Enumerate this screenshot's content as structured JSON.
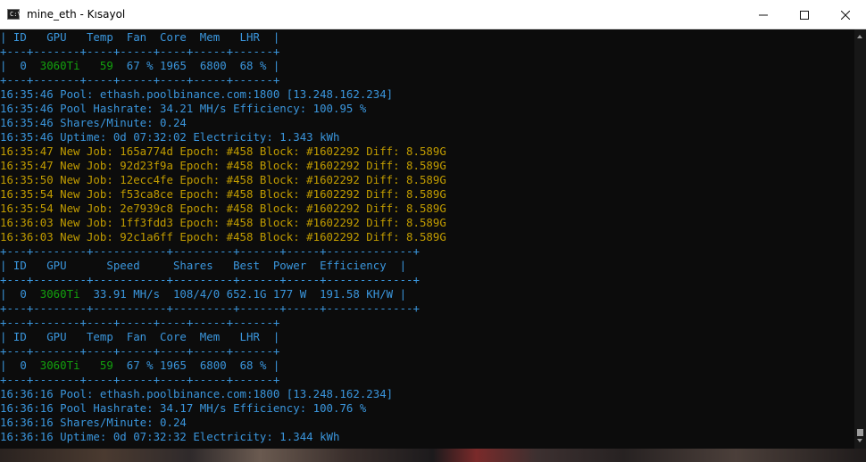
{
  "window": {
    "title": "mine_eth - Kısayol",
    "icon_name": "console-app-icon",
    "icon_glyph": "C:\\",
    "controls": {
      "minimize": "minimize-icon",
      "maximize": "maximize-icon",
      "close": "close-icon"
    }
  },
  "colors": {
    "background": "#0c0c0c",
    "cyan": "#3a96dd",
    "yellow": "#c19c00",
    "green": "#13a10e"
  },
  "console": {
    "lines": [
      {
        "text": "| ID   GPU   Temp  Fan  Core  Mem   LHR  |",
        "color": "cyan"
      },
      {
        "text": "+---+-------+----+-----+----+-----+------+",
        "color": "cyan"
      },
      {
        "text": "|  0  3060Ti   59  67 % 1965  6800  68 % |",
        "color": "cyan"
      },
      {
        "text": "+---+-------+----+-----+----+-----+------+",
        "color": "cyan"
      },
      {
        "text": "16:35:46 Pool: ethash.poolbinance.com:1800 [13.248.162.234]",
        "color": "cyan"
      },
      {
        "text": "16:35:46 Pool Hashrate: 34.21 MH/s Efficiency: 100.95 %",
        "color": "cyan"
      },
      {
        "text": "16:35:46 Shares/Minute: 0.24",
        "color": "cyan"
      },
      {
        "text": "16:35:46 Uptime: 0d 07:32:02 Electricity: 1.343 kWh",
        "color": "cyan"
      },
      {
        "text": "16:35:47 New Job: 165a774d Epoch: #458 Block: #1602292 Diff: 8.589G",
        "color": "yellow"
      },
      {
        "text": "16:35:47 New Job: 92d23f9a Epoch: #458 Block: #1602292 Diff: 8.589G",
        "color": "yellow"
      },
      {
        "text": "16:35:50 New Job: 12ecc4fe Epoch: #458 Block: #1602292 Diff: 8.589G",
        "color": "yellow"
      },
      {
        "text": "16:35:54 New Job: f53ca8ce Epoch: #458 Block: #1602292 Diff: 8.589G",
        "color": "yellow"
      },
      {
        "text": "16:35:54 New Job: 2e7939c8 Epoch: #458 Block: #1602292 Diff: 8.589G",
        "color": "yellow"
      },
      {
        "text": "16:36:03 New Job: 1ff3fdd3 Epoch: #458 Block: #1602292 Diff: 8.589G",
        "color": "yellow"
      },
      {
        "text": "16:36:03 New Job: 92c1a6ff Epoch: #458 Block: #1602292 Diff: 8.589G",
        "color": "yellow"
      },
      {
        "text": "+---+--------+-----------+---------+------+-----+-------------+",
        "color": "cyan"
      },
      {
        "text": "| ID   GPU      Speed     Shares   Best  Power  Efficiency  |",
        "color": "cyan"
      },
      {
        "text": "+---+--------+-----------+---------+------+-----+-------------+",
        "color": "cyan"
      },
      {
        "text": "|  0  3060Ti  33.91 MH/s  108/4/0 652.1G 177 W  191.58 KH/W |",
        "color": "cyan"
      },
      {
        "text": "+---+--------+-----------+---------+------+-----+-------------+",
        "color": "cyan"
      },
      {
        "text": "+---+-------+----+-----+----+-----+------+",
        "color": "cyan"
      },
      {
        "text": "| ID   GPU   Temp  Fan  Core  Mem   LHR  |",
        "color": "cyan"
      },
      {
        "text": "+---+-------+----+-----+----+-----+------+",
        "color": "cyan"
      },
      {
        "text": "|  0  3060Ti   59  67 % 1965  6800  68 % |",
        "color": "cyan"
      },
      {
        "text": "+---+-------+----+-----+----+-----+------+",
        "color": "cyan"
      },
      {
        "text": "16:36:16 Pool: ethash.poolbinance.com:1800 [13.248.162.234]",
        "color": "cyan"
      },
      {
        "text": "16:36:16 Pool Hashrate: 34.17 MH/s Efficiency: 100.76 %",
        "color": "cyan"
      },
      {
        "text": "16:36:16 Shares/Minute: 0.24",
        "color": "cyan"
      },
      {
        "text": "16:36:16 Uptime: 0d 07:32:32 Electricity: 1.344 kWh",
        "color": "cyan"
      }
    ],
    "green_values": [
      "3060Ti",
      "59"
    ]
  }
}
